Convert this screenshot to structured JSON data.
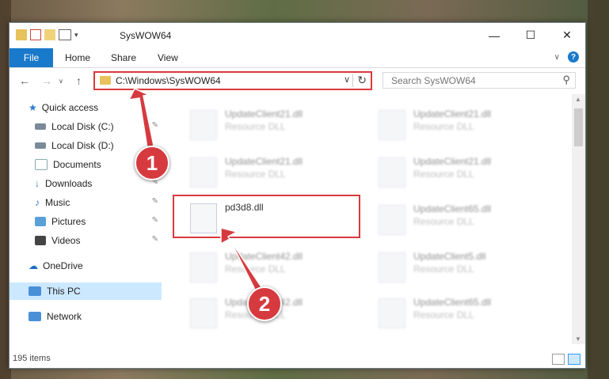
{
  "window": {
    "title": "SysWOW64"
  },
  "ribbon": {
    "file": "File",
    "tabs": [
      "Home",
      "Share",
      "View"
    ],
    "help": "?"
  },
  "address": {
    "path": "C:\\Windows\\SysWOW64",
    "dropdown": "∨",
    "refresh": "↻"
  },
  "search": {
    "placeholder": "Search SysWOW64"
  },
  "sidebar": {
    "items": [
      {
        "label": "Quick access"
      },
      {
        "label": "Local Disk (C:)"
      },
      {
        "label": "Local Disk (D:)"
      },
      {
        "label": "Documents"
      },
      {
        "label": "Downloads"
      },
      {
        "label": "Music"
      },
      {
        "label": "Pictures"
      },
      {
        "label": "Videos"
      },
      {
        "label": "OneDrive"
      },
      {
        "label": "This PC"
      },
      {
        "label": "Network"
      }
    ]
  },
  "files": [
    {
      "name": "UpdateClient21.dll",
      "type": "Resource DLL"
    },
    {
      "name": "UpdateClient21.dll",
      "type": "Resource DLL"
    },
    {
      "name": "UpdateClient21.dll",
      "type": "Resource DLL"
    },
    {
      "name": "UpdateClient21.dll",
      "type": "Resource DLL"
    },
    {
      "name": "pd3d8.dll",
      "type": ""
    },
    {
      "name": "UpdateClient65.dll",
      "type": "Resource DLL"
    },
    {
      "name": "UpdateClient42.dll",
      "type": "Resource DLL"
    },
    {
      "name": "UpdateClient5.dll",
      "type": "Resource DLL"
    },
    {
      "name": "UpdateClient42.dll",
      "type": "Resource DLL"
    },
    {
      "name": "UpdateClient65.dll",
      "type": "Resource DLL"
    }
  ],
  "status": {
    "count": "195 items"
  },
  "annotations": {
    "step1": "1",
    "step2": "2"
  },
  "colors": {
    "accent": "#1979ca",
    "highlight": "#d9393e",
    "selected": "#cce8ff"
  }
}
